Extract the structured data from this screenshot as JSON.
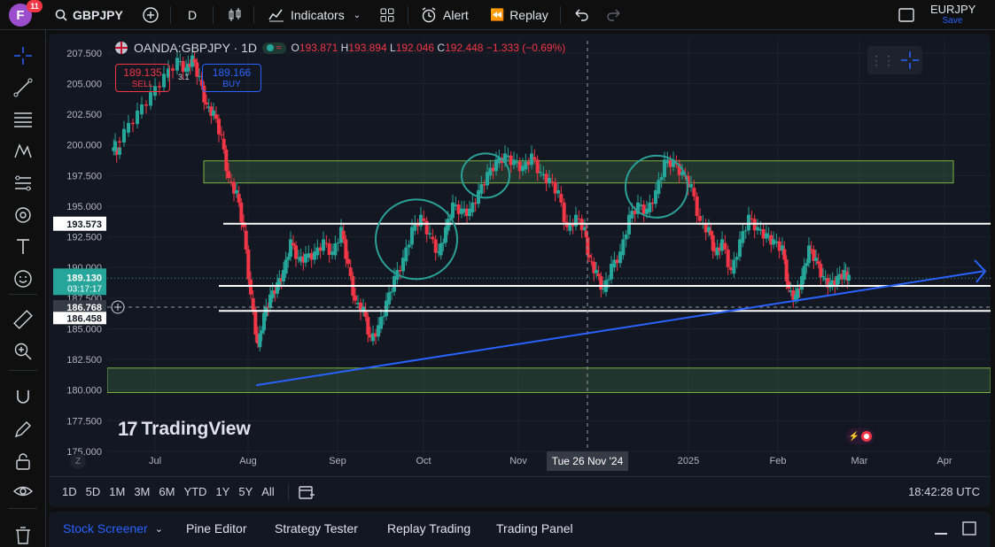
{
  "topbar": {
    "avatar_letter": "F",
    "notifications": "11",
    "symbol": "GBPJPY",
    "interval": "D",
    "indicators_label": "Indicators",
    "alert_label": "Alert",
    "replay_label": "Replay",
    "watch_symbol": "EURJPY",
    "save_label": "Save"
  },
  "legend": {
    "title": "OANDA:GBPJPY · 1D",
    "o_label": "O",
    "o_value": "193.871",
    "h_label": "H",
    "h_value": "193.894",
    "l_label": "L",
    "l_value": "192.046",
    "c_label": "C",
    "c_value": "192.448",
    "change": "−1.333 (−0.69%)"
  },
  "trade": {
    "sell_price": "189.135",
    "sell_label": "SELL",
    "spread": "3.1",
    "buy_price": "189.166",
    "buy_label": "BUY"
  },
  "price_axis": {
    "ticks": [
      "207.500",
      "205.000",
      "202.500",
      "200.000",
      "197.500",
      "195.000",
      "192.500",
      "190.000",
      "187.500",
      "185.000",
      "182.500",
      "180.000",
      "177.500",
      "175.000"
    ],
    "level_193": "193.573",
    "current_price": "189.130",
    "countdown": "03:17:17",
    "level_186": "186.768",
    "level_186b": "186.458"
  },
  "time_axis": {
    "labels": [
      "Jul",
      "Aug",
      "Sep",
      "Oct",
      "Nov",
      "2025",
      "Feb",
      "Mar",
      "Apr"
    ],
    "crosshair_label": "Tue 26 Nov '24",
    "z_label": "Z"
  },
  "watermark": "TradingView",
  "ranges": [
    "1D",
    "5D",
    "1M",
    "3M",
    "6M",
    "YTD",
    "1Y",
    "5Y",
    "All"
  ],
  "clock": "18:42:28 UTC",
  "bottom_tabs": [
    "Stock Screener",
    "Pine Editor",
    "Strategy Tester",
    "Replay Trading",
    "Trading Panel"
  ],
  "colors": {
    "up": "#26a69a",
    "down": "#f23645",
    "accent": "#2962ff",
    "zone": "#66bb6a"
  },
  "icons": [
    "crosshair-icon",
    "trendline-icon",
    "fib-icon",
    "pattern-icon",
    "projection-icon",
    "brush-icon",
    "text-icon",
    "emoji-icon",
    "ruler-icon",
    "zoom-icon",
    "magnet-icon",
    "pencil-lock-icon",
    "lock-icon",
    "eye-icon",
    "trash-icon"
  ],
  "chart_data": {
    "type": "candlestick",
    "symbol": "OANDA:GBPJPY",
    "interval": "1D",
    "ylim": [
      175,
      208.5
    ],
    "horizontal_levels": [
      193.573,
      188.5,
      186.458
    ],
    "zones": [
      [
        196.9,
        198.7
      ],
      [
        179.8,
        181.8
      ]
    ],
    "trendline": {
      "from": [
        "Aug",
        180.4
      ],
      "to": [
        "Mar",
        189.5
      ]
    },
    "last_close": 189.13
  }
}
